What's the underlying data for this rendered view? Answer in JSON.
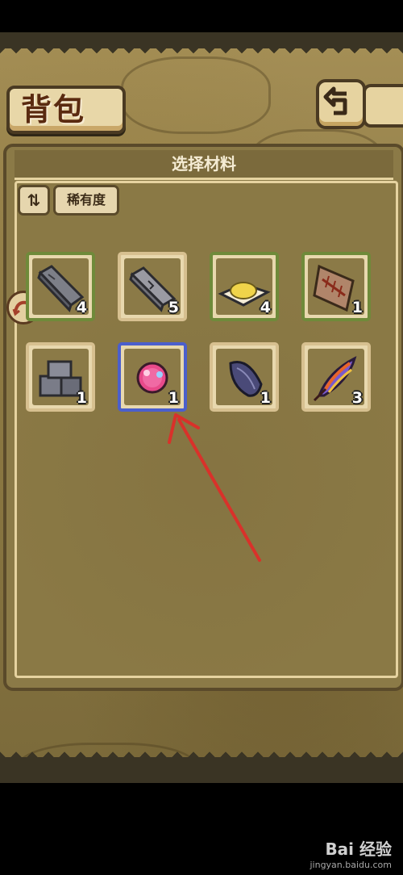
{
  "title": "背包",
  "panel": {
    "header": "选择材料",
    "sort_icon": "sort-toggle-icon",
    "rarity_label": "稀有度"
  },
  "items": [
    {
      "name": "gray-stone-bar",
      "count": "4",
      "border": "green"
    },
    {
      "name": "cracked-stone-bar",
      "count": "5",
      "border": "tan"
    },
    {
      "name": "yellow-powder",
      "count": "4",
      "border": "green"
    },
    {
      "name": "fish-bone-tablet",
      "count": "1",
      "border": "green"
    },
    {
      "name": "stone-blocks",
      "count": "1",
      "border": "tan"
    },
    {
      "name": "pink-orb",
      "count": "1",
      "border": "selected"
    },
    {
      "name": "dark-seed",
      "count": "1",
      "border": "tan"
    },
    {
      "name": "rainbow-feather",
      "count": "3",
      "border": "tan"
    }
  ],
  "colors": {
    "selected_border": "#4b5fcc",
    "green_border": "#6f8a3a",
    "arrow": "#d9312a"
  },
  "watermark": {
    "logo": "Bai 经验",
    "url": "jingyan.baidu.com"
  }
}
